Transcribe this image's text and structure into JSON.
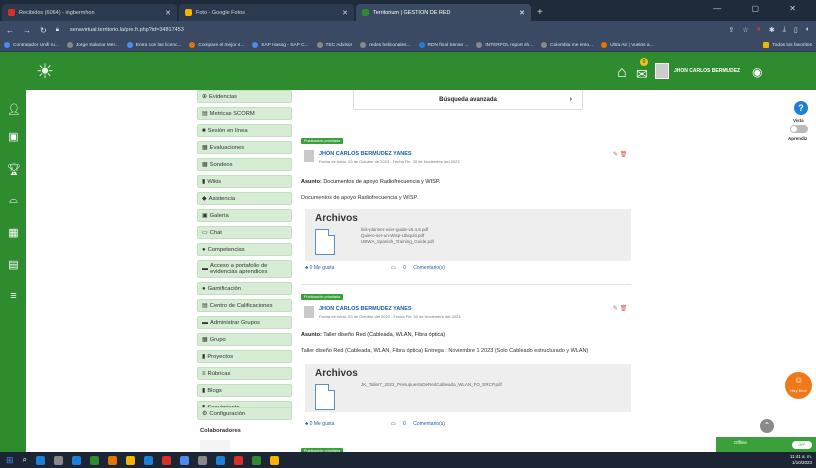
{
  "browser": {
    "tabs": [
      {
        "label": "Recibidos (6064) - ingbermhon",
        "color": "#d93025"
      },
      {
        "label": "Foto - Google Fotos",
        "color": "#f4b400"
      },
      {
        "label": "Territorium | GESTION DE RED",
        "color": "#2e8b2e"
      }
    ],
    "new_tab": "+",
    "window_controls": "— ▢ ✕",
    "url": "senavirtual.territorio.la/pre.fr.php?id=34817453",
    "bookmarks": [
      {
        "label": "Contratador Unifi ru...",
        "color": "#4c8bf5"
      },
      {
        "label": "Jorge Salazar Mer...",
        "color": "#888"
      },
      {
        "label": "Entra con las licenc...",
        "color": "#4c8bf5"
      },
      {
        "label": "Compare el mejor s...",
        "color": "#e37400"
      },
      {
        "label": "SAP Hasog - SAP C...",
        "color": "#4c8bf5"
      },
      {
        "label": "TEC Advisor",
        "color": "#888"
      },
      {
        "label": "redes heliconales...",
        "color": "#888"
      },
      {
        "label": "RDN final Sense ...",
        "color": "#1e7fd8"
      },
      {
        "label": "INTERFOL report sh...",
        "color": "#888"
      },
      {
        "label": "Colombia me ento...",
        "color": "#888"
      },
      {
        "label": "Ultra Air | Vuelos a...",
        "color": "#e37400"
      },
      {
        "label": "Todos los favoritos",
        "color": "#f4b400"
      }
    ]
  },
  "header": {
    "logo": "☀",
    "notifications_count": "0",
    "username": "JHON CARLOS BERMUDEZ"
  },
  "leftbar_icons": [
    "user-icon",
    "course-icon",
    "trophy-icon",
    "inbox-icon",
    "calendar-icon",
    "list-icon",
    "menu-icon"
  ],
  "tools": [
    {
      "icon": "⊕",
      "label": "Evidencias"
    },
    {
      "icon": "▤",
      "label": "Metricas SCORM"
    },
    {
      "icon": "■",
      "label": "Sesión en línea"
    },
    {
      "icon": "▦",
      "label": "Evaluaciones"
    },
    {
      "icon": "▦",
      "label": "Sondeos"
    },
    {
      "icon": "▮",
      "label": "Wikis"
    },
    {
      "icon": "◆",
      "label": "Asistencia"
    },
    {
      "icon": "▣",
      "label": "Galería"
    },
    {
      "icon": "▭",
      "label": "Chat"
    },
    {
      "icon": "●",
      "label": "Competencias"
    },
    {
      "icon": "▬",
      "label": "Acceso a portafolio de evidencias aprendices"
    },
    {
      "icon": "●",
      "label": "Gamificación"
    },
    {
      "icon": "▤",
      "label": "Centro de Calificaciones"
    },
    {
      "icon": "▬",
      "label": "Administrar Grupos"
    },
    {
      "icon": "▦",
      "label": "Grupo"
    },
    {
      "icon": "▮",
      "label": "Proyectos"
    },
    {
      "icon": "≡",
      "label": "Rúbricas"
    },
    {
      "icon": "▮",
      "label": "Blogs"
    },
    {
      "icon": "▮",
      "label": "Seguimiento"
    },
    {
      "icon": "⚙",
      "label": "Configuración"
    }
  ],
  "collaborators_label": "Colaboradores",
  "search": {
    "label": "Búsqueda avanzada",
    "chevron": "›"
  },
  "posts": [
    {
      "tag": "Publicación prioritaria",
      "author": "JHON CARLOS BERMUDEZ YANES",
      "dates": "Fecha de inicio: 03 de Octubre de 2023 - Fecha Fin: 30 de Noviembre del 2023",
      "subject_label": "Asunto:",
      "subject": "Documentos de apoyo Radiofrecuencia y WISP.",
      "description": "Documentos de apoyo Radiofrecuencia y WISP.",
      "files_title": "Archivos",
      "files": [
        "link-planner-user-guide-v5.4.5.pdf",
        "Quiero-ser-un-Wisp-Ubiquiti.pdf",
        "UBWA_Spanish_Training_Guide.pdf"
      ],
      "likes": "0 Me gusta",
      "comments_count": "0",
      "comments_label": "Comentario(s)"
    },
    {
      "tag": "Publicación prioritaria",
      "author": "JHON CARLOS BERMUDEZ YANES",
      "dates": "Fecha de inicio: 03 de Octubre del 2023 - Fecha Fin: 30 de Noviembre del 2023",
      "subject_label": "Asunto:",
      "subject": "Taller diseño Red (Cableada, WLAN, Fibra óptica)",
      "description": "Taller diseño Red (Cableada, WLAN, Fibra óptica) Entrega : Noviembre 1 2023 (Solo Cableado estructurado y WLAN)",
      "files_title": "Archivos",
      "files": [
        "JK_Taller7_2022_PresupuestoDeRedCableada_WLAN_FO_ERCP.pdf"
      ],
      "likes": "0 Me gusta",
      "comments_count": "0",
      "comments_label": "Comentario(s)"
    }
  ],
  "third_post_tag": "Publicación prioritaria",
  "right": {
    "help": "?",
    "vista_label": "Vista",
    "aprendiz_label": "Aprendiz",
    "badge_label": "Hey Emi!",
    "offline_label": "Offline",
    "offline_switch": "OFF"
  },
  "taskbar": {
    "time": "11:41 a. m.",
    "date": "1/10/2023",
    "apps": [
      "#1e7fd8",
      "#888",
      "#1e7fd8",
      "#2e8b2e",
      "#e37400",
      "#f4b400",
      "#1e7fd8",
      "#d93025",
      "#4c8bf5",
      "#888",
      "#1e7fd8",
      "#d93025",
      "#2e8b2e",
      "#f4b400"
    ]
  }
}
